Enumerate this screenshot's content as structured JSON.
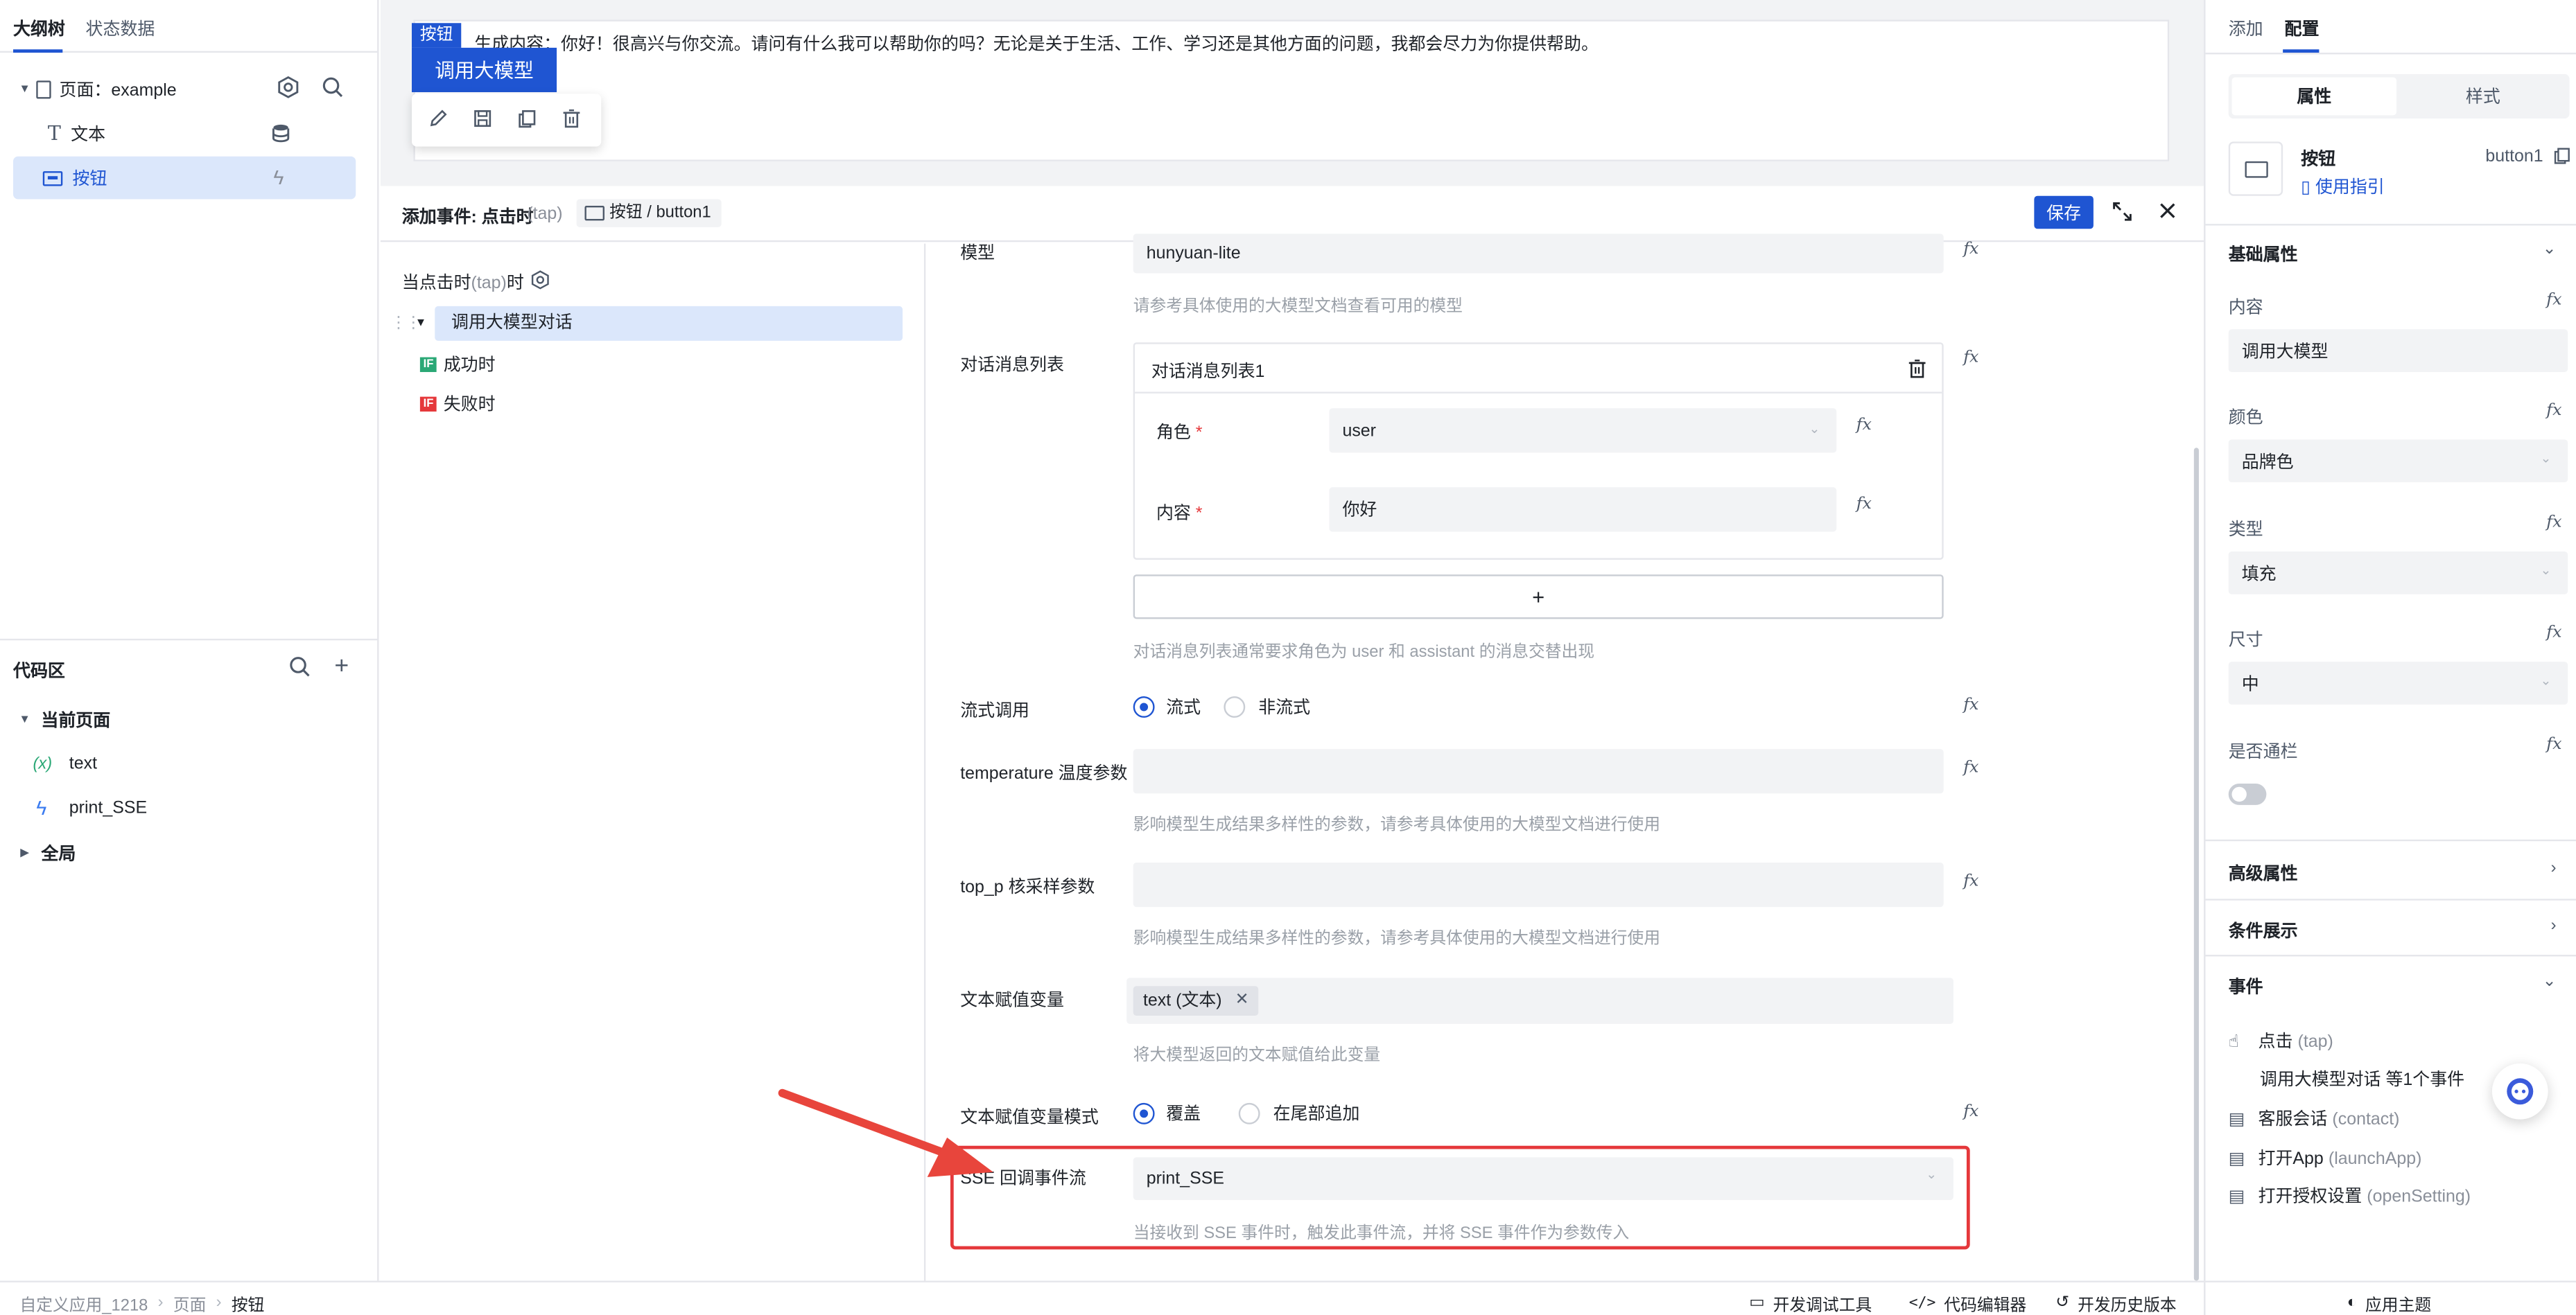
{
  "left": {
    "tabs": [
      "大纲树",
      "状态数据"
    ],
    "tree": {
      "page_label": "页面：example",
      "items": [
        {
          "label": "文本",
          "icon": "text-icon"
        },
        {
          "label": "按钮",
          "icon": "button-icon"
        }
      ]
    },
    "code": {
      "title": "代码区",
      "current_page": "当前页面",
      "items": [
        {
          "label": "text",
          "icon": "variable-icon",
          "glyph": "(x)"
        },
        {
          "label": "print_SSE",
          "icon": "lightning-icon",
          "glyph": "ϟ"
        }
      ],
      "global": "全局"
    }
  },
  "canvas": {
    "preview_text": "生成内容：你好！很高兴与你交流。请问有什么我可以帮助你的吗？无论是关于生活、工作、学习还是其他方面的问题，我都会尽力为你提供帮助。",
    "tag": "按钮",
    "button_label": "调用大模型"
  },
  "event": {
    "header_title": "添加事件: 点击时",
    "header_sub": "(tap)",
    "header_target": "按钮 / button1",
    "save_label": "保存",
    "trigger_label": "当点击时",
    "trigger_sub": "(tap)",
    "trigger_suffix": "时",
    "action_label": "调用大模型对话",
    "success_label": "成功时",
    "fail_label": "失败时",
    "if_badge": "IF"
  },
  "form": {
    "model_label": "模型",
    "model_value": "hunyuan-lite",
    "model_hint": "请参考具体使用的大模型文档查看可用的模型",
    "messages_label": "对话消息列表",
    "messages_card_title": "对话消息列表1",
    "role_label": "角色",
    "role_value": "user",
    "content_label": "内容",
    "content_value": "你好",
    "required_mark": "*",
    "add_label": "+",
    "messages_hint": "对话消息列表通常要求角色为 user 和 assistant 的消息交替出现",
    "stream_label": "流式调用",
    "stream_on": "流式",
    "stream_off": "非流式",
    "temperature_label": "temperature 温度参数",
    "temperature_hint": "影响模型生成结果多样性的参数，请参考具体使用的大模型文档进行使用",
    "top_p_label": "top_p 核采样参数",
    "top_p_hint": "影响模型生成结果多样性的参数，请参考具体使用的大模型文档进行使用",
    "text_var_label": "文本赋值变量",
    "text_var_tag": "text (文本)",
    "text_var_hint": "将大模型返回的文本赋值给此变量",
    "mode_label": "文本赋值变量模式",
    "mode_cover": "覆盖",
    "mode_append": "在尾部追加",
    "sse_label": "SSE 回调事件流",
    "sse_value": "print_SSE",
    "sse_hint": "当接收到 SSE 事件时，触发此事件流，并将 SSE 事件作为参数传入",
    "fx": "fx"
  },
  "right": {
    "tabs": [
      "添加",
      "配置"
    ],
    "subtabs": [
      "属性",
      "样式"
    ],
    "component_name": "按钮",
    "component_id": "button1",
    "guide_label": "使用指引",
    "basic_title": "基础属性",
    "props": [
      {
        "label": "内容",
        "value": "调用大模型"
      },
      {
        "label": "颜色",
        "value": "品牌色"
      },
      {
        "label": "类型",
        "value": "填充"
      },
      {
        "label": "尺寸",
        "value": "中"
      }
    ],
    "block_label": "是否通栏",
    "advanced_title": "高级属性",
    "condition_title": "条件展示",
    "events_title": "事件",
    "events": [
      {
        "label": "点击",
        "sub": "(tap)"
      },
      {
        "label": "客服会话",
        "sub": "(contact)"
      },
      {
        "label": "打开App",
        "sub": "(launchApp)"
      },
      {
        "label": "打开授权设置",
        "sub": "(openSetting)"
      }
    ],
    "tap_summary": "调用大模型对话 等1个事件"
  },
  "status": {
    "breadcrumb": [
      "自定义应用_1218",
      "页面",
      "按钮"
    ],
    "tools": [
      "开发调试工具",
      "代码编辑器",
      "开发历史版本"
    ],
    "theme": "应用主题"
  },
  "colors": {
    "brand": "#1f55d2",
    "highlight_border": "#e5383b",
    "arrow": "#e8453c"
  }
}
